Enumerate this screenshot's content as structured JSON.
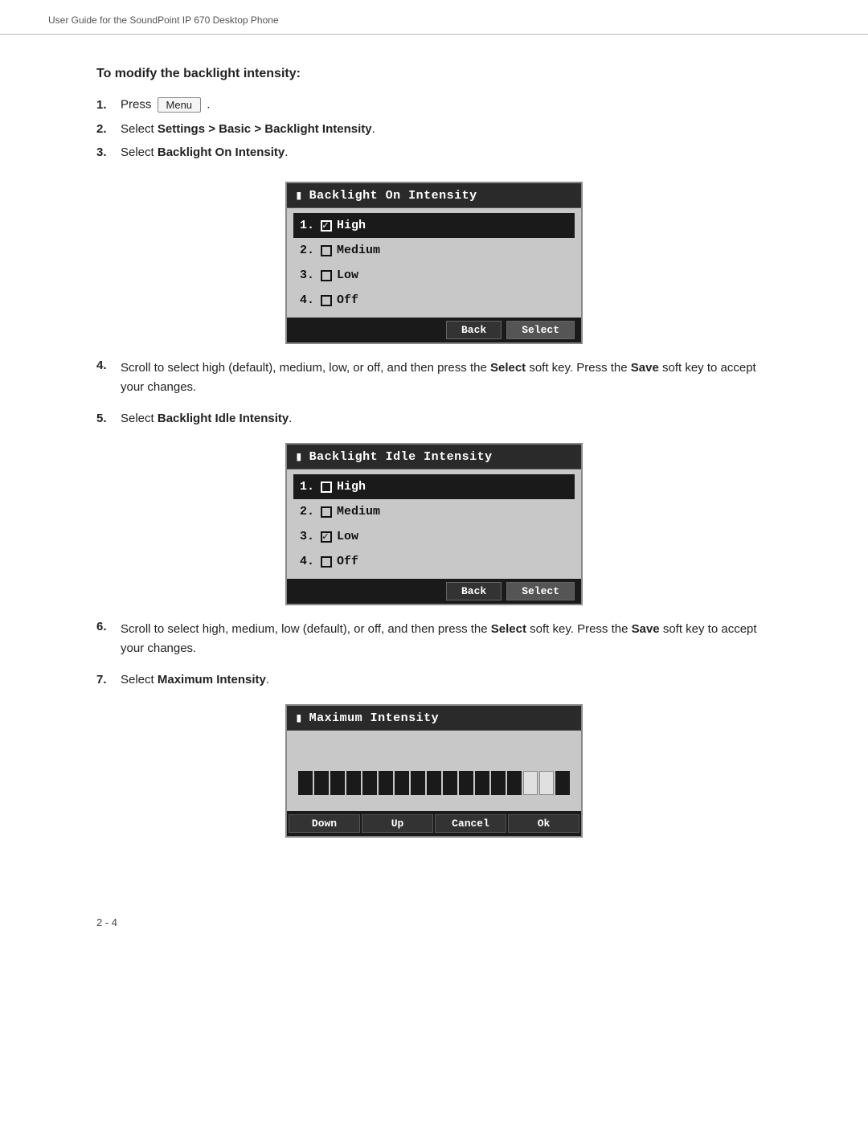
{
  "header": {
    "text": "User Guide for the SoundPoint IP 670 Desktop Phone"
  },
  "section": {
    "heading": "To modify the backlight intensity:"
  },
  "steps": [
    {
      "number": "1.",
      "text": "Press",
      "has_button": true,
      "button_label": "Menu"
    },
    {
      "number": "2.",
      "text": "Select Settings > Basic > Backlight Intensity.",
      "bold_parts": [
        "Settings > Basic > Backlight Intensity"
      ]
    },
    {
      "number": "3.",
      "text": "Select Backlight On Intensity.",
      "bold_parts": [
        "Backlight On Intensity"
      ]
    }
  ],
  "screen1": {
    "title": "Backlight On Intensity",
    "items": [
      {
        "num": "1.",
        "checked": true,
        "label": "High",
        "selected": true
      },
      {
        "num": "2.",
        "checked": false,
        "label": "Medium",
        "selected": false
      },
      {
        "num": "3.",
        "checked": false,
        "label": "Low",
        "selected": false
      },
      {
        "num": "4.",
        "checked": false,
        "label": "Off",
        "selected": false
      }
    ],
    "footer_buttons": [
      "Back",
      "Select"
    ]
  },
  "step4": {
    "number": "4.",
    "text1": "Scroll to select high (default), medium, low, or off, and then press the",
    "bold1": "Select",
    "text2": "soft key. Press the",
    "bold2": "Save",
    "text3": "soft key to accept your changes."
  },
  "step5": {
    "number": "5.",
    "text": "Select",
    "bold": "Backlight Idle Intensity",
    "text2": "."
  },
  "screen2": {
    "title": "Backlight Idle Intensity",
    "items": [
      {
        "num": "1.",
        "checked": false,
        "label": "High",
        "selected": true
      },
      {
        "num": "2.",
        "checked": false,
        "label": "Medium",
        "selected": false
      },
      {
        "num": "3.",
        "checked": true,
        "label": "Low",
        "selected": false
      },
      {
        "num": "4.",
        "checked": false,
        "label": "Off",
        "selected": false
      }
    ],
    "footer_buttons": [
      "Back",
      "Select"
    ]
  },
  "step6": {
    "number": "6.",
    "text1": "Scroll to select high, medium, low (default), or off, and then press the",
    "bold1": "Select",
    "text2": "soft key. Press the",
    "bold2": "Save",
    "text3": "soft key to accept your changes."
  },
  "step7": {
    "number": "7.",
    "text": "Select",
    "bold": "Maximum Intensity",
    "text2": "."
  },
  "screen3": {
    "title": "Maximum Intensity",
    "footer_buttons": [
      "Down",
      "Up",
      "Cancel",
      "Ok"
    ]
  },
  "page_number": "2 - 4"
}
